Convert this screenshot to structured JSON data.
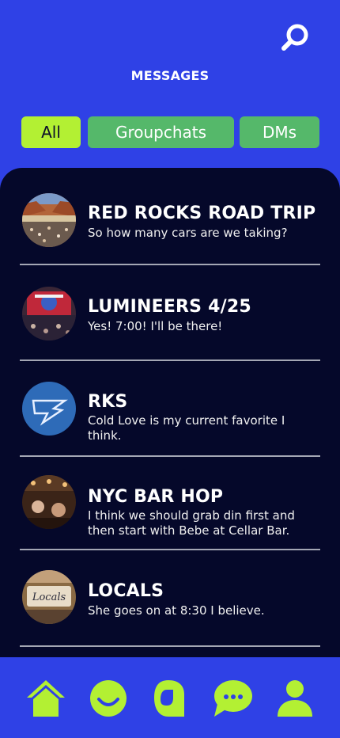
{
  "header": {
    "title": "MESSAGES",
    "search_icon": "search-icon"
  },
  "filters": {
    "all": "All",
    "groupchats": "Groupchats",
    "dms": "DMs",
    "selected": "All"
  },
  "conversations": [
    {
      "name": "RED ROCKS ROAD TRIP",
      "preview": "So how many cars are we taking?"
    },
    {
      "name": "LUMINEERS 4/25",
      "preview": "Yes! 7:00! I'll be there!"
    },
    {
      "name": "RKS",
      "preview": "Cold Love is my current favorite I think."
    },
    {
      "name": "NYC BAR HOP",
      "preview": "I think we should grab din first and then start with Bebe at Cellar Bar."
    },
    {
      "name": "LOCALS",
      "preview": "She goes on at 8:30 I believe."
    }
  ],
  "tabbar": {
    "items": [
      "home-icon",
      "smiley-icon",
      "letter-a-icon",
      "chat-bubble-icon",
      "profile-icon"
    ]
  },
  "colors": {
    "background": "#2f41e6",
    "panel": "#05082a",
    "accent": "#b3f033",
    "chip": "#55b86a"
  }
}
